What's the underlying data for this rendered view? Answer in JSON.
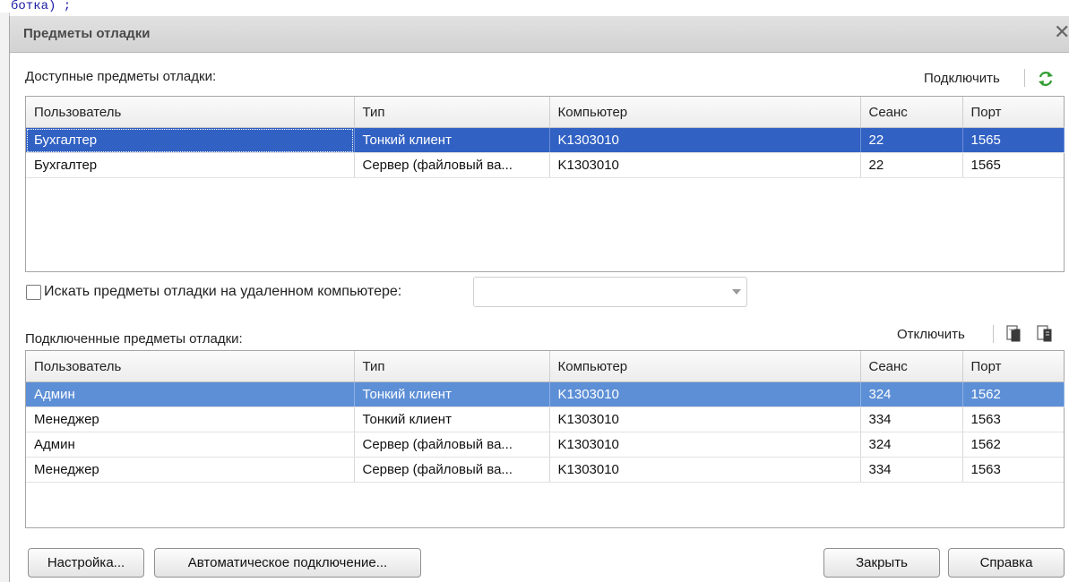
{
  "background": {
    "code_fragment": "ботка) ;"
  },
  "dialog": {
    "title": "Предметы отладки",
    "available": {
      "label": "Доступные предметы отладки:",
      "connect_label": "Подключить",
      "refresh_icon": "refresh-icon",
      "columns": [
        "Пользователь",
        "Тип",
        "Компьютер",
        "Сеанс",
        "Порт"
      ],
      "rows": [
        {
          "user": "Бухгалтер",
          "type": "Тонкий клиент",
          "computer": "K1303010",
          "session": "22",
          "port": "1565"
        },
        {
          "user": "Бухгалтер",
          "type": "Сервер (файловый ва...",
          "computer": "K1303010",
          "session": "22",
          "port": "1565"
        }
      ]
    },
    "remote_search": {
      "label": "Искать предметы отладки на удаленном компьютере:",
      "checked": false,
      "value": ""
    },
    "connected": {
      "label": "Подключенные предметы отладки:",
      "disconnect_label": "Отключить",
      "columns": [
        "Пользователь",
        "Тип",
        "Компьютер",
        "Сеанс",
        "Порт"
      ],
      "rows": [
        {
          "user": "Админ",
          "type": "Тонкий клиент",
          "computer": "K1303010",
          "session": "324",
          "port": "1562"
        },
        {
          "user": "Менеджер",
          "type": "Тонкий клиент",
          "computer": "K1303010",
          "session": "334",
          "port": "1563"
        },
        {
          "user": "Админ",
          "type": "Сервер (файловый ва...",
          "computer": "K1303010",
          "session": "324",
          "port": "1562"
        },
        {
          "user": "Менеджер",
          "type": "Сервер (файловый ва...",
          "computer": "K1303010",
          "session": "334",
          "port": "1563"
        }
      ]
    },
    "buttons": {
      "settings": "Настройка...",
      "auto_connect": "Автоматическое подключение...",
      "close": "Закрыть",
      "help": "Справка"
    },
    "colors": {
      "selection_focused": "#3161c3",
      "selection_unfocused": "#5d8fd6"
    }
  }
}
